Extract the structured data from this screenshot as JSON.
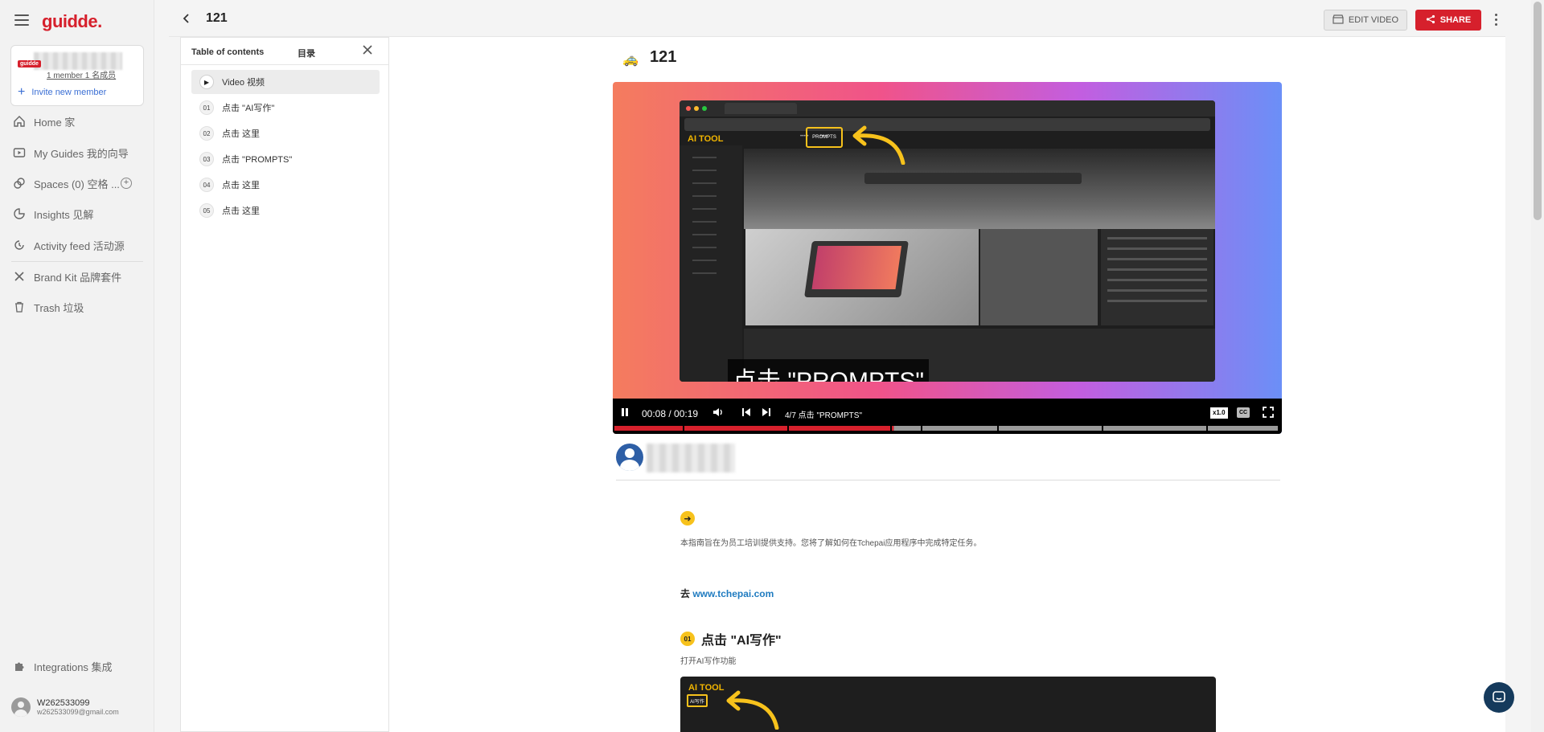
{
  "app": {
    "logo": "guidde."
  },
  "workspace": {
    "badge": "guidde",
    "members": "1 member 1 名成员",
    "invite": "Invite new member"
  },
  "nav": {
    "home": "Home 家",
    "my_guides": "My Guides 我的向导",
    "spaces": "Spaces (0) 空格 ...",
    "insights": "Insights 见解",
    "activity": "Activity feed 活动源",
    "brand_kit": "Brand Kit 品牌套件",
    "trash": "Trash 垃圾",
    "integrations": "Integrations 集成"
  },
  "user": {
    "name": "W262533099",
    "email": "w262533099@gmail.com"
  },
  "header": {
    "title": "121",
    "edit_label": "EDIT VIDEO",
    "share_label": "SHARE"
  },
  "toc": {
    "title": "Table of contents",
    "title_cn": "目录",
    "items": [
      {
        "num": "",
        "label": "Video 视频"
      },
      {
        "num": "01",
        "label": "点击 \"AI写作\""
      },
      {
        "num": "02",
        "label": "点击 这里"
      },
      {
        "num": "03",
        "label": "点击 \"PROMPTS\""
      },
      {
        "num": "04",
        "label": "点击 这里"
      },
      {
        "num": "05",
        "label": "点击 这里"
      }
    ]
  },
  "video": {
    "title": "121",
    "caption": "点击 \"PROMPTS\"",
    "time": "00:08 / 00:19",
    "chapter": "4/7 点击 \"PROMPTS\"",
    "speed": "x1.0",
    "cc": "CC",
    "progress": 0.42,
    "screenshot": {
      "brand": "AI TOOL",
      "highlight": "PROMPTS"
    }
  },
  "content": {
    "intro": "本指南旨在为员工培训提供支持。您将了解如何在Tchepai应用程序中完成特定任务。",
    "go_prefix": "去 ",
    "go_link": "www.tchepai.com",
    "step1": {
      "num": "01",
      "title": "点击 \"AI写作\"",
      "desc": "打开AI写作功能"
    },
    "step1_shot": {
      "brand": "AI TOOL",
      "highlight": "AI写作"
    }
  },
  "colors": {
    "brand": "#d6202c",
    "accent": "#f7c21c",
    "link": "#1f7bc0"
  }
}
